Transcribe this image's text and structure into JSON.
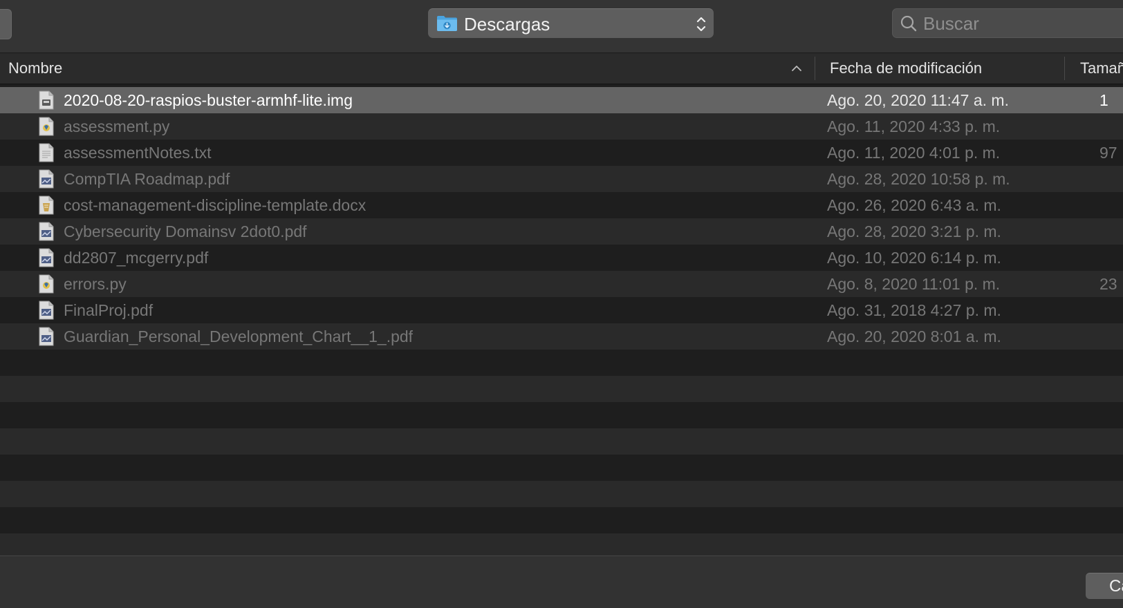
{
  "toolbar": {
    "location": "Descargas",
    "search_placeholder": "Buscar"
  },
  "columns": {
    "name": "Nombre",
    "date": "Fecha de modificación",
    "size": "Tamaño"
  },
  "files": [
    {
      "name": "2020-08-20-raspios-buster-armhf-lite.img",
      "date": "Ago. 20, 2020 11:47 a. m.",
      "size": "1",
      "icon": "disk-image-icon",
      "selected": true
    },
    {
      "name": "assessment.py",
      "date": "Ago. 11, 2020 4:33 p. m.",
      "size": "",
      "icon": "python-file-icon",
      "selected": false
    },
    {
      "name": "assessmentNotes.txt",
      "date": "Ago. 11, 2020 4:01 p. m.",
      "size": "97",
      "icon": "text-file-icon",
      "selected": false
    },
    {
      "name": "CompTIA Roadmap.pdf",
      "date": "Ago. 28, 2020 10:58 p. m.",
      "size": "",
      "icon": "pdf-file-icon",
      "selected": false
    },
    {
      "name": "cost-management-discipline-template.docx",
      "date": "Ago. 26, 2020 6:43 a. m.",
      "size": "",
      "icon": "docx-file-icon",
      "selected": false
    },
    {
      "name": "Cybersecurity Domainsv 2dot0.pdf",
      "date": "Ago. 28, 2020 3:21 p. m.",
      "size": "",
      "icon": "pdf-file-icon",
      "selected": false
    },
    {
      "name": "dd2807_mcgerry.pdf",
      "date": "Ago. 10, 2020 6:14 p. m.",
      "size": "",
      "icon": "pdf-file-icon",
      "selected": false
    },
    {
      "name": "errors.py",
      "date": "Ago. 8, 2020 11:01 p. m.",
      "size": "23",
      "icon": "python-file-icon",
      "selected": false
    },
    {
      "name": "FinalProj.pdf",
      "date": "Ago. 31, 2018 4:27 p. m.",
      "size": "",
      "icon": "pdf-file-icon",
      "selected": false
    },
    {
      "name": "Guardian_Personal_Development_Chart__1_.pdf",
      "date": "Ago. 20, 2020 8:01 a. m.",
      "size": "",
      "icon": "pdf-file-icon",
      "selected": false
    }
  ],
  "empty_rows": 8,
  "bottom": {
    "cancel_label": "Cancelar"
  },
  "colors": {
    "selection": "#646464",
    "folder_accent": "#4aa3df"
  }
}
